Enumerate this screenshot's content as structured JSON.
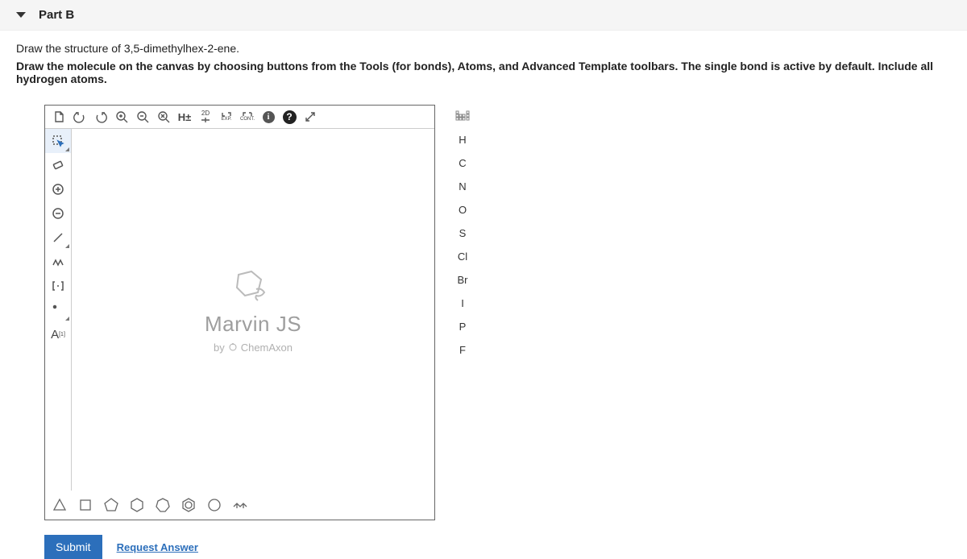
{
  "header": {
    "title": "Part B"
  },
  "prompt": {
    "line1": "Draw the structure of 3,5-dimethylhex-2-ene.",
    "line2": "Draw the molecule on the canvas by choosing buttons from the Tools (for bonds), Atoms, and Advanced Template toolbars. The single bond is active by default. Include all hydrogen atoms."
  },
  "top_toolbar": {
    "h_toggle": "H±",
    "two_d": "2D",
    "exp": "EXP.",
    "cont": "CONT."
  },
  "canvas": {
    "brand": "Marvin JS",
    "by": "by",
    "company": "ChemAxon"
  },
  "left_tools": {
    "abbrev": "A",
    "abbrev_sup": "[1]"
  },
  "right_panel": {
    "atoms": [
      "H",
      "C",
      "N",
      "O",
      "S",
      "Cl",
      "Br",
      "I",
      "P",
      "F"
    ]
  },
  "actions": {
    "submit": "Submit",
    "request": "Request Answer"
  }
}
